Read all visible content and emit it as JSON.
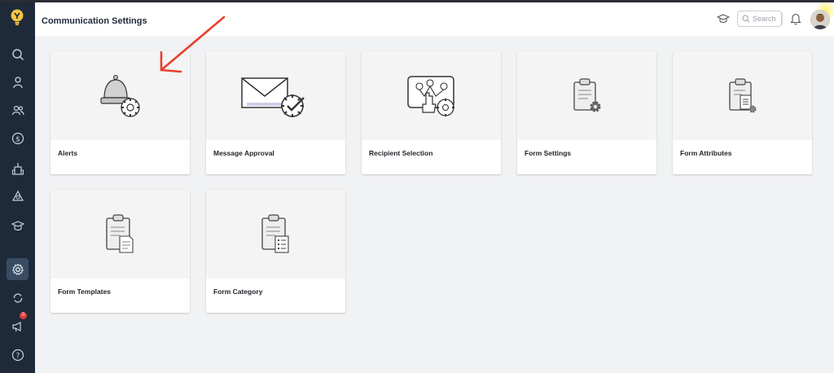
{
  "header": {
    "title": "Communication Settings",
    "search_placeholder": "Search"
  },
  "sidebar": {
    "items": [
      {
        "icon": "search-icon"
      },
      {
        "icon": "person-icon"
      },
      {
        "icon": "users-icon"
      },
      {
        "icon": "dollar-icon"
      },
      {
        "icon": "building-icon"
      },
      {
        "icon": "network-icon"
      },
      {
        "icon": "graduation-cap-icon"
      },
      {
        "icon": "gear-icon",
        "active": true
      },
      {
        "icon": "refresh-icon"
      },
      {
        "icon": "megaphone-icon",
        "badge": "0"
      },
      {
        "icon": "help-icon"
      }
    ]
  },
  "cards": [
    {
      "label": "Alerts",
      "icon": "bell-gear-icon"
    },
    {
      "label": "Message Approval",
      "icon": "envelope-gear-icon"
    },
    {
      "label": "Recipient Selection",
      "icon": "recipient-gear-icon"
    },
    {
      "label": "Form Settings",
      "icon": "clipboard-gear-icon"
    },
    {
      "label": "Form Attributes",
      "icon": "clipboard-doc-gear-icon"
    },
    {
      "label": "Form Templates",
      "icon": "clipboard-doc-icon"
    },
    {
      "label": "Form Category",
      "icon": "clipboard-list-icon"
    }
  ],
  "colors": {
    "sidebar_bg": "#1e2a3a",
    "active_item": "#3a4c63",
    "annotation_arrow": "#e8402e",
    "badge": "#e23b3b"
  }
}
